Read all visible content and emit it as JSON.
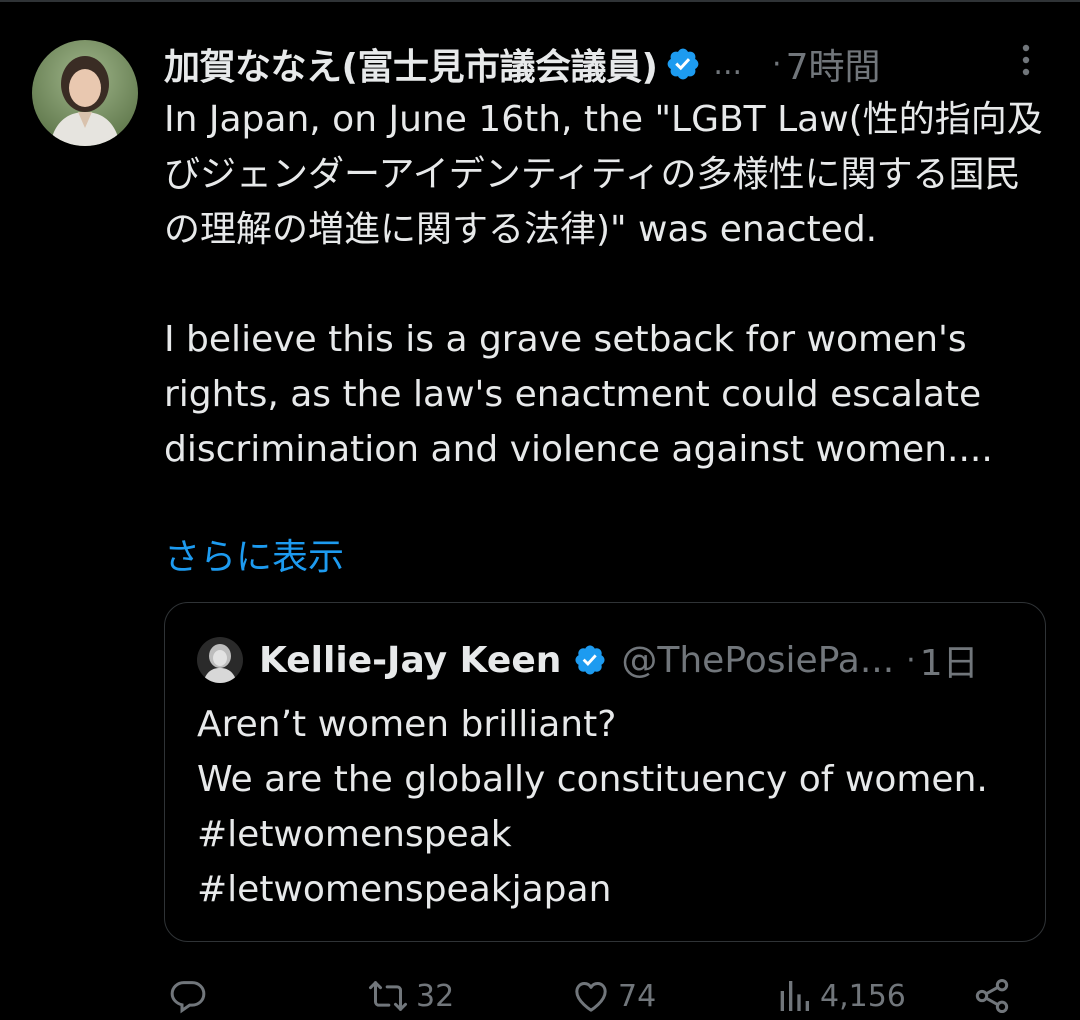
{
  "colors": {
    "background": "#000000",
    "text": "#e7e9ea",
    "secondary": "#71767b",
    "link": "#1d9bf0",
    "verified": "#1d9bf0",
    "border": "#2f3336"
  },
  "tweet": {
    "author_name": "加賀ななえ(富士見市議会議員)",
    "header_ellipsis": "...",
    "dot": "·",
    "time": "7時間",
    "body": "In Japan, on June 16th, the \"LGBT Law(性的指向及びジェンダーアイデンティティの多様性に関する国民の理解の増進に関する法律)\" was enacted.\n\nI believe this is a grave setback for women's rights, as the law's enactment could escalate discrimination and violence against women....",
    "show_more": "さらに表示"
  },
  "quote": {
    "author_name": "Kellie-Jay Keen",
    "handle": "@ThePosiePa...",
    "dot": "·",
    "time": "1日",
    "text": "Aren’t women brilliant?\nWe are the globally constituency of women.  #letwomenspeak\n#letwomenspeakjapan"
  },
  "actions": {
    "reply_count": "",
    "retweet_count": "32",
    "like_count": "74",
    "view_count": "4,156"
  },
  "icons": {
    "more": "more-vertical-icon",
    "verified": "verified-badge-icon",
    "reply": "reply-icon",
    "retweet": "retweet-icon",
    "like": "heart-icon",
    "views": "views-icon",
    "share": "share-icon"
  }
}
